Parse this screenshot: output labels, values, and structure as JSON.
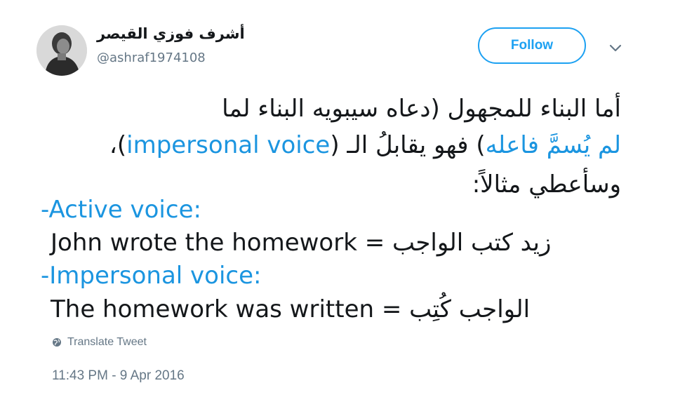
{
  "user": {
    "name": "أشرف فوزي القيصر",
    "handle": "@ashraf1974108"
  },
  "follow_label": "Follow",
  "tweet": {
    "line1": "أما البناء للمجهول (دعاه سيبويه البناء لما",
    "line2_part1": "لم يُسمَّ فاعله",
    "line2_part2": ") فهو يقابلُ الـ (",
    "line2_part3": "impersonal voice",
    "line2_part4": ")،",
    "line3": "وسأعطي مثالاً:",
    "active_heading": "-Active voice:",
    "active_example": "John wrote the homework = زيد كتب الواجب",
    "impersonal_heading": "-Impersonal voice:",
    "impersonal_example": "The homework was written = الواجب كُتِب"
  },
  "translate_label": "Translate Tweet",
  "timestamp": "11:43 PM - 9 Apr 2016",
  "colors": {
    "accent": "#1da1f2",
    "link": "#1b95e0",
    "muted": "#657786",
    "text": "#14171a"
  },
  "icons": {
    "caret": "chevron-down-icon",
    "translate": "globe-icon"
  }
}
